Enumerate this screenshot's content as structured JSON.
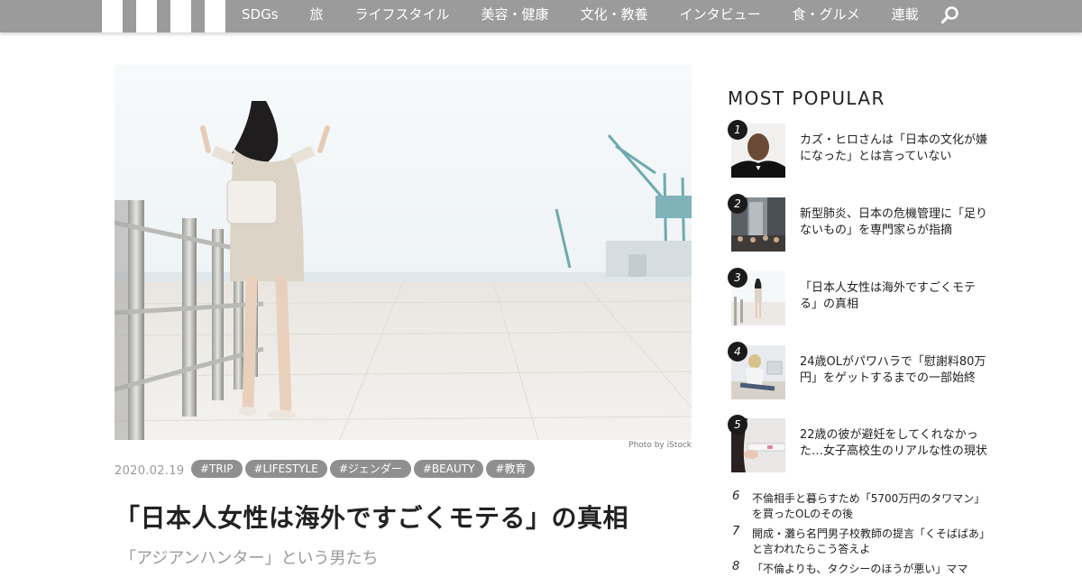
{
  "nav": {
    "items": [
      "SDGs",
      "旅",
      "ライフスタイル",
      "美容・健康",
      "文化・教養",
      "インタビュー",
      "食・グルメ",
      "連載"
    ],
    "search_icon": "search-icon"
  },
  "article": {
    "photo_credit": "Photo by iStock",
    "date": "2020.02.19",
    "tags": [
      "#TRIP",
      "#LIFESTYLE",
      "#ジェンダー",
      "#BEAUTY",
      "#教育"
    ],
    "title": "「日本人女性は海外ですごくモテる」の真相",
    "subtitle": "「アジアンハンター」という男たち"
  },
  "sidebar": {
    "heading": "MOST POPULAR",
    "ranked": [
      {
        "num": "1",
        "text": "カズ・ヒロさんは「日本の文化が嫌になった」とは言っていない"
      },
      {
        "num": "2",
        "text": "新型肺炎、日本の危機管理に「足りないもの」を専門家らが指摘"
      },
      {
        "num": "3",
        "text": "「日本人女性は海外ですごくモテる」の真相"
      },
      {
        "num": "4",
        "text": "24歳OLがパワハラで「慰謝料80万円」をゲットするまでの一部始終"
      },
      {
        "num": "5",
        "text": "22歳の彼が避妊をしてくれなかった…女子高校生のリアルな性の現状"
      }
    ],
    "more": [
      {
        "num": "6",
        "text": "不倫相手と暮らすため「5700万円のタワマン」を買ったOLのその後"
      },
      {
        "num": "7",
        "text": "開成・灘ら名門男子校教師の提言「くそばばあ」と言われたらこう答えよ"
      },
      {
        "num": "8",
        "text": "「不倫よりも、タクシーのほうが悪い」ママ"
      }
    ]
  }
}
